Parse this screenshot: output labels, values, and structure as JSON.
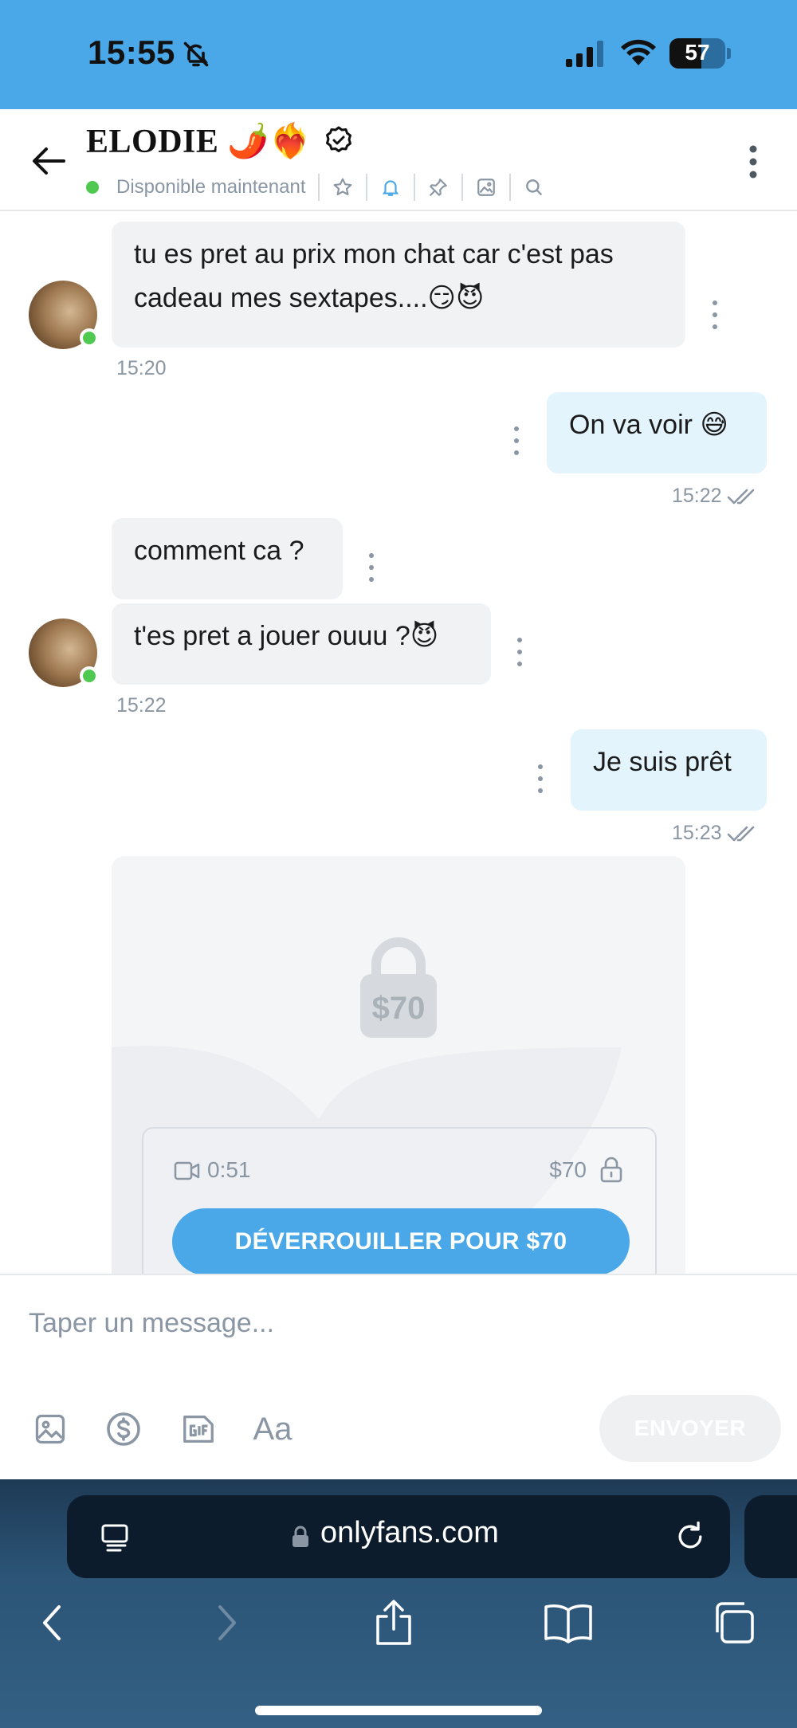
{
  "status_bar": {
    "time": "15:55",
    "battery": "57",
    "battery_level": 0.57
  },
  "header": {
    "contact_name": "ELODIE 🌶️❤️‍🔥",
    "status": "Disponible maintenant"
  },
  "messages": [
    {
      "id": "m1",
      "direction": "in",
      "text": "tu es pret au prix mon chat car c'est pas cadeau mes sextapes....😏😈"
    },
    {
      "id": "t1",
      "text": "15:20"
    },
    {
      "id": "m2",
      "direction": "out",
      "text": "On va voir 😅"
    },
    {
      "id": "t2",
      "text": "15:22"
    },
    {
      "id": "m3",
      "direction": "in",
      "text": "comment ca ?"
    },
    {
      "id": "m4",
      "direction": "in",
      "text": "t'es pret a jouer ouuu ?😈"
    },
    {
      "id": "t3",
      "text": "15:22"
    },
    {
      "id": "m5",
      "direction": "out",
      "text": "Je suis prêt"
    },
    {
      "id": "t4",
      "text": "15:23"
    }
  ],
  "locked_media": {
    "badge_price": "$70",
    "duration": "0:51",
    "price": "$70",
    "unlock_label": "DÉVERROUILLER POUR $70"
  },
  "composer": {
    "placeholder": "Taper un message...",
    "text_tool": "Aa",
    "send_label": "ENVOYER"
  },
  "browser": {
    "url": "onlyfans.com"
  },
  "colors": {
    "accent": "#4aa8e8",
    "online": "#4fc94f",
    "incoming_bubble": "#f1f2f4",
    "outgoing_bubble": "#e3f4fd",
    "muted": "#8a96a3"
  }
}
